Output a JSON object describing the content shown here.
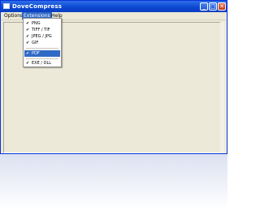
{
  "window": {
    "title": "DoveCompress"
  },
  "menubar": {
    "items": [
      {
        "label": "Options"
      },
      {
        "label": "Extensions"
      },
      {
        "label": "Help"
      }
    ]
  },
  "extensions_menu": {
    "items": [
      {
        "label": "PNG",
        "checked": true,
        "check": "✔"
      },
      {
        "label": "TIFF / TIF",
        "checked": true,
        "check": "✔"
      },
      {
        "label": "JPEG / JPG",
        "checked": true,
        "check": "✔"
      },
      {
        "label": "GIF",
        "checked": true,
        "check": "✔"
      },
      {
        "label": "PDF",
        "checked": true,
        "check": "✔",
        "highlighted": true
      },
      {
        "label": "EXE / DLL",
        "checked": true,
        "check": "✔"
      }
    ]
  },
  "colors": {
    "titlebar": "#0b46d0",
    "menu_highlight": "#316ac5",
    "window_bg": "#ece9d8"
  }
}
